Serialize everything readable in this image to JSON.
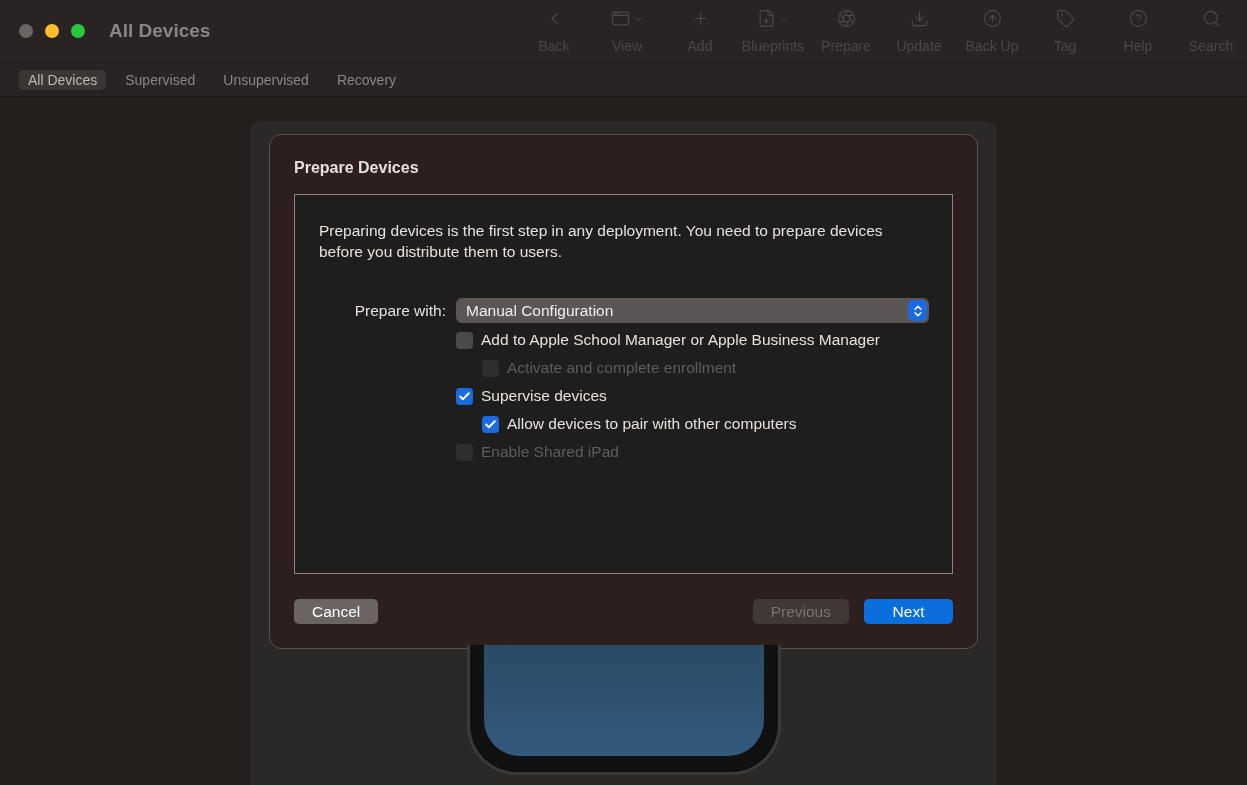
{
  "window": {
    "title": "All Devices"
  },
  "toolbar": [
    {
      "kind": "back",
      "label": "Back",
      "menu": false,
      "disabled": true
    },
    {
      "kind": "view",
      "label": "View",
      "menu": true,
      "disabled": true
    },
    {
      "kind": "add",
      "label": "Add",
      "menu": false,
      "disabled": true
    },
    {
      "kind": "blueprints",
      "label": "Blueprints",
      "menu": true,
      "disabled": true
    },
    {
      "kind": "prepare",
      "label": "Prepare",
      "menu": false,
      "disabled": true
    },
    {
      "kind": "update",
      "label": "Update",
      "menu": false,
      "disabled": true
    },
    {
      "kind": "backup",
      "label": "Back Up",
      "menu": false,
      "disabled": true
    },
    {
      "kind": "tag",
      "label": "Tag",
      "menu": false,
      "disabled": true
    },
    {
      "kind": "help",
      "label": "Help",
      "menu": false,
      "disabled": true
    },
    {
      "kind": "search",
      "label": "Search",
      "menu": false,
      "disabled": true
    }
  ],
  "scope_tabs": [
    {
      "label": "All Devices",
      "selected": true
    },
    {
      "label": "Supervised",
      "selected": false
    },
    {
      "label": "Unsupervised",
      "selected": false
    },
    {
      "label": "Recovery",
      "selected": false
    }
  ],
  "sheet": {
    "title": "Prepare Devices",
    "description": "Preparing devices is the first step in any deployment. You need to prepare devices before you distribute them to users.",
    "prepare_with": {
      "label": "Prepare with:",
      "value": "Manual Configuration"
    },
    "options": [
      {
        "label": "Add to Apple School Manager or Apple Business Manager",
        "checked": false,
        "disabled": false,
        "children": [
          {
            "label": "Activate and complete enrollment",
            "checked": false,
            "disabled": true
          }
        ]
      },
      {
        "label": "Supervise devices",
        "checked": true,
        "disabled": false,
        "children": [
          {
            "label": "Allow devices to pair with other computers",
            "checked": true,
            "disabled": false
          }
        ]
      },
      {
        "label": "Enable Shared iPad",
        "checked": false,
        "disabled": true
      }
    ],
    "buttons": [
      {
        "label": "Cancel",
        "kind": "normal",
        "disabled": false
      },
      {
        "label": "Previous",
        "kind": "normal",
        "disabled": true
      },
      {
        "label": "Next",
        "kind": "default",
        "disabled": false
      }
    ]
  }
}
